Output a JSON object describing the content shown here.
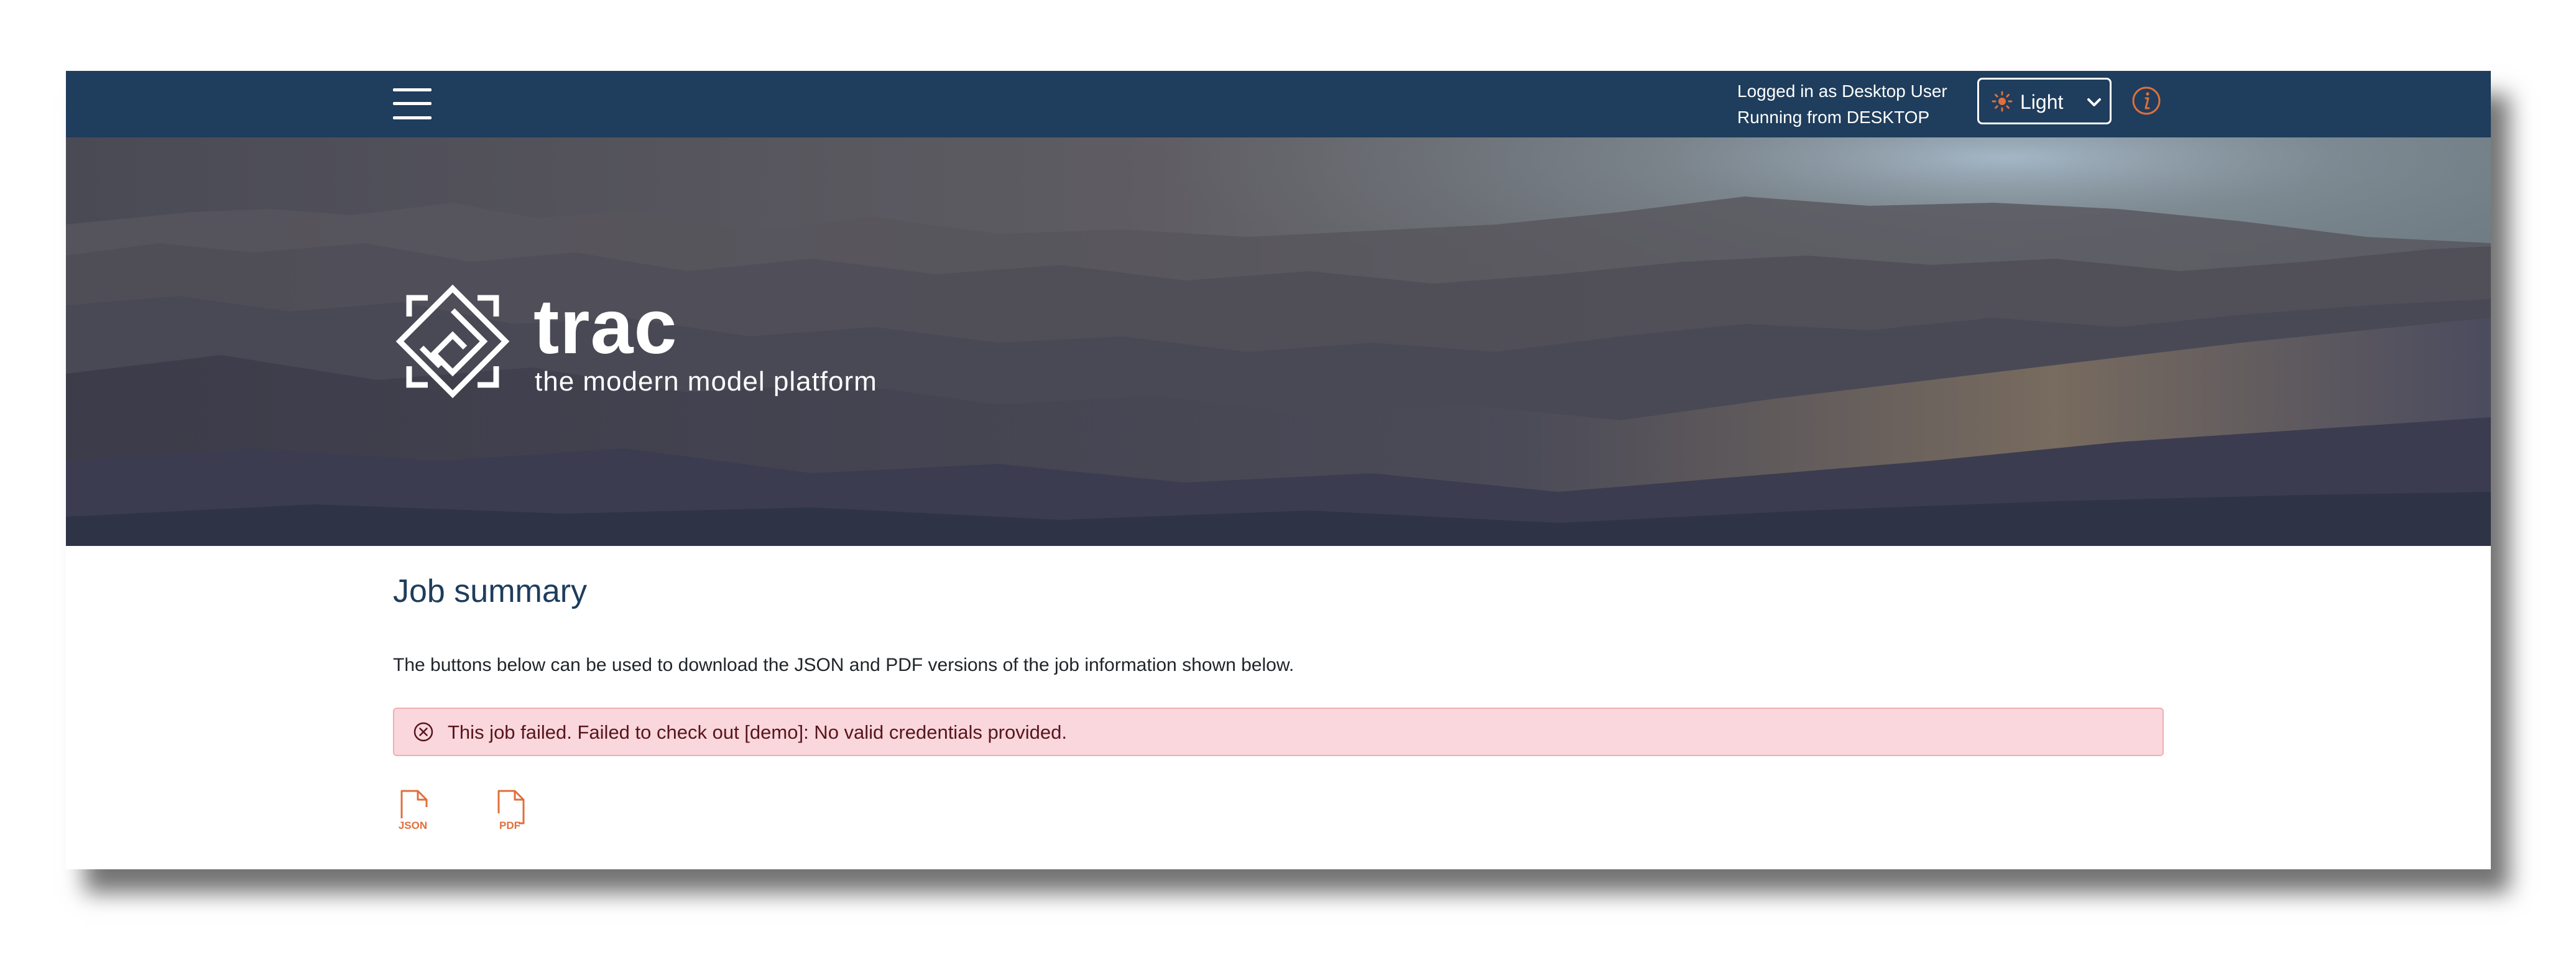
{
  "topbar": {
    "menu_icon": "hamburger-menu-icon",
    "user_line": "Logged in as Desktop User",
    "host_line": "Running from DESKTOP",
    "theme": {
      "icon": "sun-icon",
      "label": "Light",
      "chevron": "chevron-down-icon"
    },
    "info_icon": "info-icon",
    "colors": {
      "bar": "#1f3d5c",
      "accent": "#e06f3c"
    }
  },
  "hero": {
    "logo_icon": "trac-logo-icon",
    "brand_name": "trac",
    "tagline": "the modern model platform"
  },
  "main": {
    "title": "Job summary",
    "description": "The buttons below can be used to download the JSON and PDF versions of the job information shown below.",
    "alert": {
      "icon": "error-circle-x-icon",
      "text": "This job failed. Failed to check out [demo]: No valid credentials provided.",
      "background": "#f9d7dc",
      "border": "#f1aeb5"
    },
    "downloads": [
      {
        "icon": "json-file-icon",
        "label": "JSON"
      },
      {
        "icon": "pdf-file-icon",
        "label": "PDF"
      }
    ]
  }
}
